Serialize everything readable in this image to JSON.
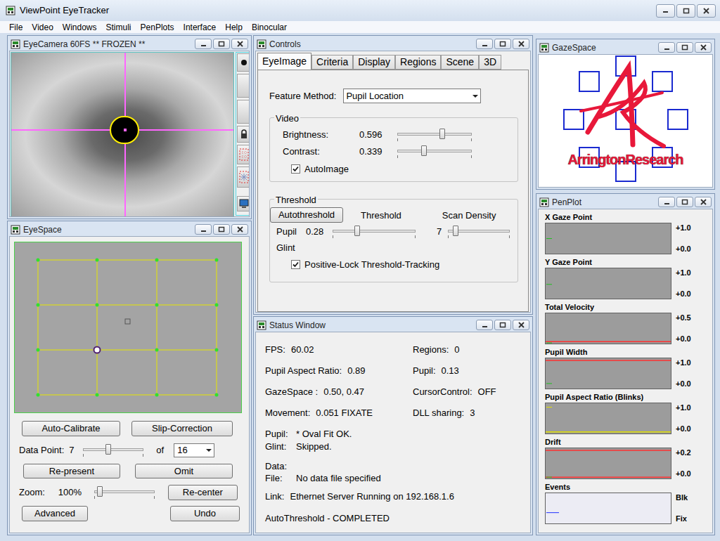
{
  "window": {
    "title": "ViewPoint EyeTracker"
  },
  "menu": [
    "File",
    "Video",
    "Windows",
    "Stimuli",
    "PenPlots",
    "Interface",
    "Help",
    "Binocular"
  ],
  "eye_camera": {
    "title": "EyeCamera 60FS ** FROZEN **"
  },
  "eye_space": {
    "title": "EyeSpace",
    "points": [
      {
        "selected": false
      },
      {
        "selected": false
      },
      {
        "selected": false
      },
      {
        "selected": false
      },
      {
        "selected": false
      },
      {
        "selected": false
      },
      {
        "selected": false
      },
      {
        "selected": false
      },
      {
        "selected": false
      },
      {
        "selected": true
      },
      {
        "selected": false
      },
      {
        "selected": false
      },
      {
        "selected": false
      },
      {
        "selected": false
      },
      {
        "selected": false
      },
      {
        "selected": false
      }
    ],
    "auto_calibrate": "Auto-Calibrate",
    "slip_correction": "Slip-Correction",
    "data_point": {
      "label": "Data Point:",
      "value": "7",
      "level": 0.42,
      "of": "of",
      "total": "16"
    },
    "re_present": "Re-present",
    "omit": "Omit",
    "zoom": {
      "label": "Zoom:",
      "value": "100%",
      "level": 0.1
    },
    "re_center": "Re-center",
    "advanced": "Advanced",
    "undo": "Undo"
  },
  "controls": {
    "title": "Controls",
    "tabs": [
      {
        "label": "EyeImage",
        "selected": true
      },
      {
        "label": "Criteria",
        "selected": false
      },
      {
        "label": "Display",
        "selected": false
      },
      {
        "label": "Regions",
        "selected": false
      },
      {
        "label": "Scene",
        "selected": false
      },
      {
        "label": "3D",
        "selected": false
      }
    ],
    "feature_method": {
      "label": "Feature Method:",
      "value": "Pupil Location"
    },
    "video": {
      "title": "Video",
      "sliders": [
        {
          "label": "Brightness:",
          "value": "0.596",
          "level": 0.6
        },
        {
          "label": "Contrast:",
          "value": "0.339",
          "level": 0.36
        }
      ],
      "auto_image": {
        "label": "AutoImage",
        "checked": true
      }
    },
    "threshold": {
      "title": "Threshold",
      "autothreshold": "Autothreshold",
      "threshold_label": "Threshold",
      "scan_density_label": "Scan Density",
      "pupil": {
        "label": "Pupil",
        "value": "0.28",
        "level": 0.3,
        "density": "7",
        "density_level": 0.12
      },
      "glint": {
        "label": "Glint"
      },
      "positive_lock": {
        "label": "Positive-Lock Threshold-Tracking",
        "checked": true
      }
    }
  },
  "status": {
    "title": "Status Window",
    "metrics": [
      {
        "label": "FPS:",
        "value": "60.02"
      },
      {
        "label": "Regions:",
        "value": "0"
      },
      {
        "label": "Pupil Aspect Ratio:",
        "value": "0.89"
      },
      {
        "label": "Pupil:",
        "value": "0.13"
      },
      {
        "label": "GazeSpace :",
        "value": "0.50,  0.47"
      },
      {
        "label": "CursorControl:",
        "value": "OFF"
      },
      {
        "label": "Movement:",
        "value": "0.051 FIXATE"
      },
      {
        "label": "DLL sharing:",
        "value": "3"
      }
    ],
    "checks": [
      {
        "label": "Pupil:",
        "value": "* Oval Fit OK."
      },
      {
        "label": "Glint:",
        "value": "Skipped."
      }
    ],
    "data_label": "Data:",
    "file": {
      "label": "File:",
      "value": "No data file specified"
    },
    "link": {
      "label": "Link:",
      "value": "Ethernet Server Running on 192.168.1.6"
    },
    "message": "AutoThreshold - COMPLETED"
  },
  "gaze_space": {
    "title": "GazeSpace",
    "logo": "ArringtonResearch"
  },
  "pen_plot": {
    "title": "PenPlot",
    "plots": [
      {
        "label": "X Gaze Point",
        "top": "+1.0",
        "bottom": "+0.0",
        "max": 1,
        "values": [
          0.5,
          0.5,
          0.5,
          0.5,
          0.5
        ],
        "color": "#22c022",
        "limits": []
      },
      {
        "label": "Y Gaze Point",
        "top": "+1.0",
        "bottom": "+0.0",
        "max": 1,
        "values": [
          0.47,
          0.47,
          0.47,
          0.47,
          0.47
        ],
        "color": "#22c022",
        "limits": []
      },
      {
        "label": "Total Velocity",
        "top": "+0.5",
        "bottom": "+0.0",
        "max": 0.5,
        "values": [
          0.0,
          0.0,
          0.0,
          0.0,
          0.0
        ],
        "color": "#22c022",
        "limits": [
          {
            "value": 0.02,
            "color": "#ff3030"
          }
        ]
      },
      {
        "label": "Pupil Width",
        "top": "+1.0",
        "bottom": "+0.0",
        "max": 1,
        "values": [
          0.15,
          0.15,
          0.15,
          0.15,
          0.15
        ],
        "color": "#22c022",
        "limits": [
          {
            "value": 0.95,
            "color": "#ff3030"
          }
        ]
      },
      {
        "label": "Pupil Aspect Ratio (Blinks)",
        "top": "+1.0",
        "bottom": "+0.0",
        "max": 1,
        "values": [
          0.89,
          0.89,
          0.89,
          0.89,
          0.89
        ],
        "color": "#e0e000",
        "limits": [
          {
            "value": 0.03,
            "color": "#e0e000"
          }
        ]
      },
      {
        "label": "Drift",
        "top": "+0.2",
        "bottom": "+0.0",
        "max": 0.2,
        "values": [
          0.004,
          0.004,
          0.004,
          0.004,
          0.004
        ],
        "color": "#22c022",
        "limits": [
          {
            "value": 0.19,
            "color": "#ff3030"
          },
          {
            "value": 0.004,
            "color": "#ff3030"
          }
        ]
      },
      {
        "label": "Events",
        "top": "Blk",
        "bottom": "Fix",
        "max": 1,
        "values": [
          0.35,
          0.35,
          0.35,
          0.35,
          0.35,
          0.35,
          0.35,
          0.35,
          0.35,
          0.35
        ],
        "color": "#2030ff",
        "limits": []
      }
    ]
  }
}
